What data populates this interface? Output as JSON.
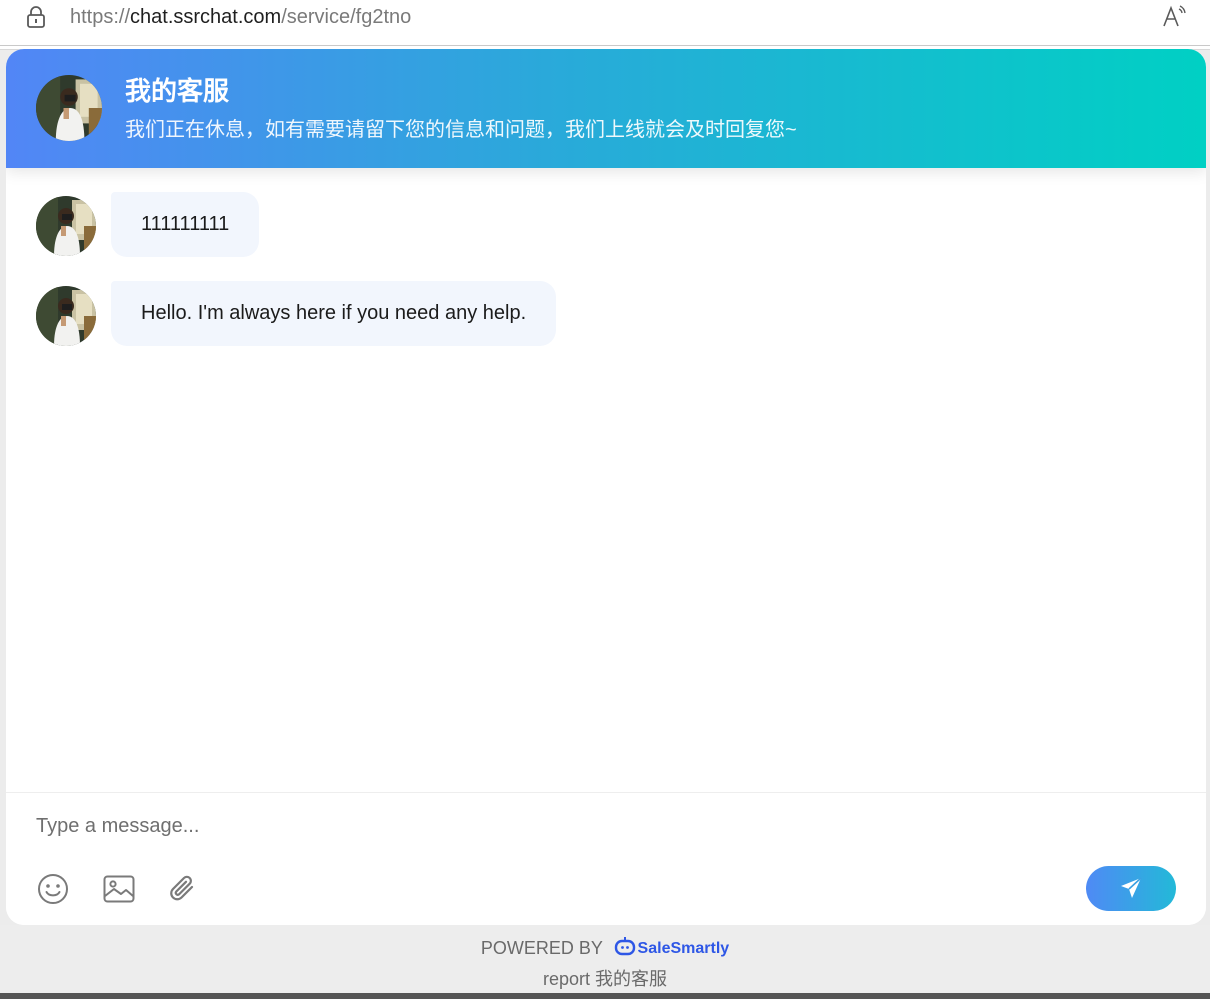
{
  "browser": {
    "url_scheme": "https://",
    "url_host": "chat.ssrchat.com",
    "url_path": "/service/fg2tno"
  },
  "header": {
    "title": "我的客服",
    "subtitle": "我们正在休息，如有需要请留下您的信息和问题，我们上线就会及时回复您~"
  },
  "messages": [
    {
      "sender": "agent",
      "text": "111111111"
    },
    {
      "sender": "agent",
      "text": "Hello. I'm always here if you need any help."
    }
  ],
  "composer": {
    "placeholder": "Type a message...",
    "tools": [
      "emoji-icon",
      "image-icon",
      "attachment-icon"
    ],
    "send_icon": "send-icon"
  },
  "footer": {
    "powered_by": "POWERED BY",
    "brand": "SaleSmartly",
    "report": "report 我的客服"
  },
  "colors": {
    "header_gradient_start": "#5286f6",
    "header_gradient_end": "#00d0c4",
    "bubble_bg": "#f2f6fd",
    "send_gradient_start": "#4f8af5",
    "send_gradient_end": "#23b9d8",
    "brand": "#2e57e6"
  }
}
